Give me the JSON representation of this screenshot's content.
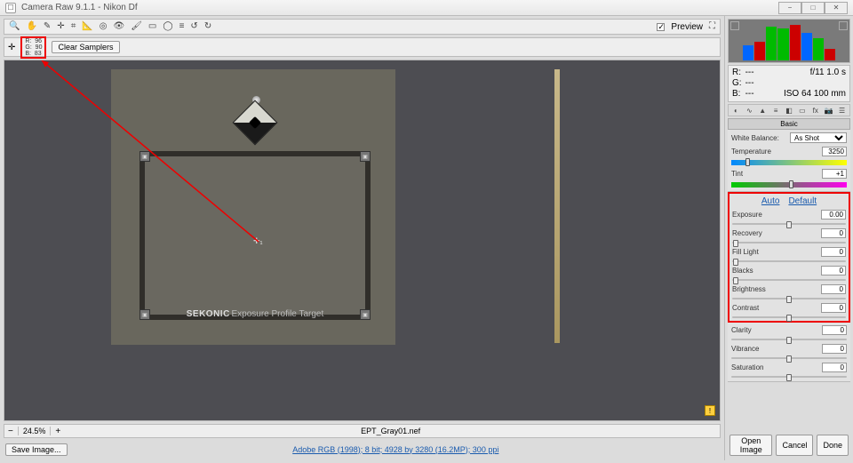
{
  "window": {
    "title": "Camera Raw 9.1.1  -  Nikon Df"
  },
  "toolbar": {
    "preview_label": "Preview"
  },
  "sampler": {
    "rgb_text": "R:  96\nG:  90\nB:  83",
    "clear_btn": "Clear Samplers"
  },
  "image": {
    "brand": "SEKONIC",
    "brand_sub": "Exposure Profile Target",
    "warn": "!",
    "cross": "✛₁"
  },
  "footer": {
    "zoom": "24.5%",
    "filename": "EPT_Gray01.nef",
    "save_btn": "Save Image...",
    "profile_link": "Adobe RGB (1998); 8 bit; 4928 by 3280 (16.2MP); 300 ppi"
  },
  "info": {
    "r": "R:",
    "g": "G:",
    "b": "B:",
    "rv": "---",
    "gv": "---",
    "bv": "---",
    "exp": "f/11  1.0 s",
    "iso": "ISO 64  100 mm"
  },
  "basic": {
    "head": "Basic",
    "wb_label": "White Balance:",
    "wb_value": "As Shot",
    "temp_label": "Temperature",
    "temp_value": "3250",
    "tint_label": "Tint",
    "tint_value": "+1",
    "auto": "Auto",
    "default": "Default",
    "exposure": "Exposure",
    "exposure_v": "0.00",
    "recovery": "Recovery",
    "recovery_v": "0",
    "fill": "Fill Light",
    "fill_v": "0",
    "blacks": "Blacks",
    "blacks_v": "0",
    "bright": "Brightness",
    "bright_v": "0",
    "contrast": "Contrast",
    "contrast_v": "0",
    "clarity": "Clarity",
    "clarity_v": "0",
    "vibrance": "Vibrance",
    "vibrance_v": "0",
    "saturation": "Saturation",
    "saturation_v": "0"
  },
  "buttons": {
    "open": "Open Image",
    "cancel": "Cancel",
    "done": "Done"
  }
}
